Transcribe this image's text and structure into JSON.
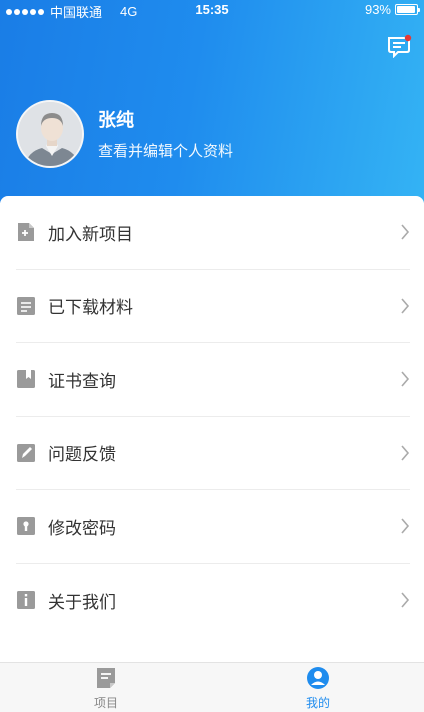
{
  "status_bar": {
    "carrier": "中国联通",
    "network": "4G",
    "time": "15:35",
    "battery": "93%",
    "battery_level": 0.93
  },
  "header": {
    "message_icon": "message-icon",
    "has_unread": true
  },
  "profile": {
    "name": "张纯",
    "subtitle": "查看并编辑个人资料"
  },
  "menu": {
    "items": [
      {
        "label": "加入新项目",
        "icon": "add-document-icon"
      },
      {
        "label": "已下载材料",
        "icon": "document-icon"
      },
      {
        "label": "证书查询",
        "icon": "bookmark-icon"
      },
      {
        "label": "问题反馈",
        "icon": "edit-icon"
      },
      {
        "label": "修改密码",
        "icon": "lock-icon"
      },
      {
        "label": "关于我们",
        "icon": "info-icon"
      }
    ]
  },
  "tabbar": {
    "tabs": [
      {
        "label": "项目",
        "icon": "project-icon",
        "active": false
      },
      {
        "label": "我的",
        "icon": "user-icon",
        "active": true
      }
    ]
  },
  "colors": {
    "header_start": "#1a7de6",
    "header_end": "#34b3f4",
    "icon_gray": "#9a9a9a",
    "active_tab": "#1f8cee",
    "badge": "#e53935"
  }
}
